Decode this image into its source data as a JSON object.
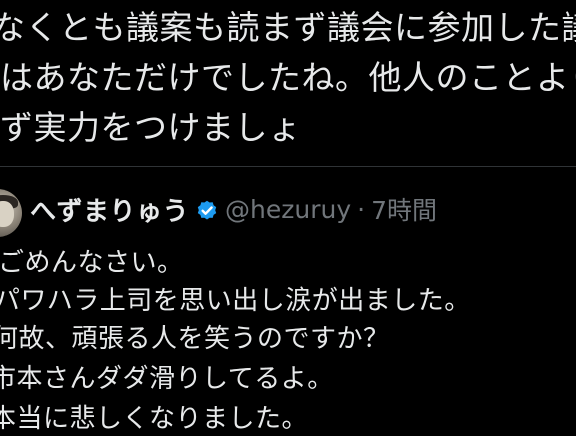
{
  "previous_tweet": {
    "lines": [
      "なくとも議案も読まず議会に参加した議",
      "はあなただけでしたね。他人のことより",
      "ず実力をつけましょ"
    ]
  },
  "reply": {
    "display_name": "へずまりゅう",
    "verified_icon": "verified-badge-icon",
    "handle": "@hezuruy",
    "separator": "·",
    "time": "7時間",
    "body_lines": [
      "ごめんなさい。",
      "パワハラ上司を思い出し涙が出ました。",
      "何故、頑張る人を笑うのですか？",
      "市本さんダダ滑りしてるよ。",
      "本当に悲しくなりました。"
    ]
  },
  "colors": {
    "background": "#000000",
    "text": "#e7e9ea",
    "secondary_text": "#71767b",
    "divider": "#2f3336",
    "verified": "#1d9bf0"
  }
}
